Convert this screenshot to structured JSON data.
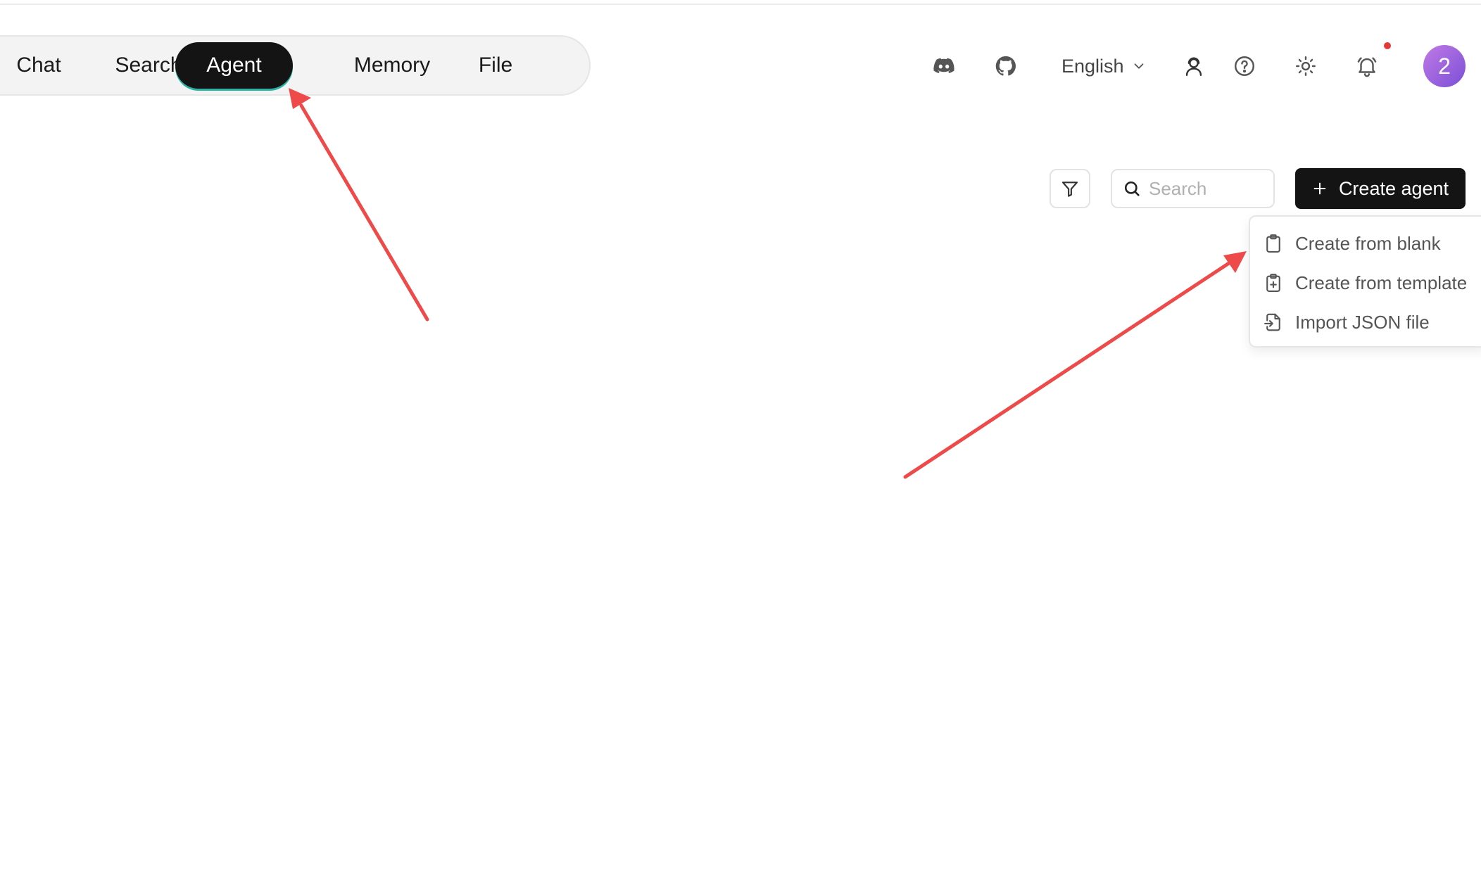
{
  "nav": {
    "items": [
      {
        "label": "Chat"
      },
      {
        "label": "Search"
      },
      {
        "label": "Agent"
      },
      {
        "label": "Memory"
      },
      {
        "label": "File"
      }
    ],
    "active": "Agent"
  },
  "header": {
    "language": "English",
    "avatar_text": "2",
    "icons": [
      "discord-icon",
      "github-icon",
      "chevron-down-icon",
      "user-headset-icon",
      "help-icon",
      "sun-icon",
      "bell-icon"
    ]
  },
  "toolbar": {
    "search_placeholder": "Search",
    "search_value": "",
    "create_label": "Create agent"
  },
  "create_menu": {
    "items": [
      {
        "label": "Create from blank",
        "icon": "clipboard-icon"
      },
      {
        "label": "Create from template",
        "icon": "clipboard-plus-icon"
      },
      {
        "label": "Import JSON file",
        "icon": "file-import-icon"
      }
    ]
  },
  "colors": {
    "accent_dark": "#141414",
    "tab_underline": "#2bb3a6",
    "annotation_arrow": "#ef4a4a",
    "notification_dot": "#e53935",
    "avatar_gradient_start": "#c07ae6",
    "avatar_gradient_end": "#7b4fd6"
  }
}
